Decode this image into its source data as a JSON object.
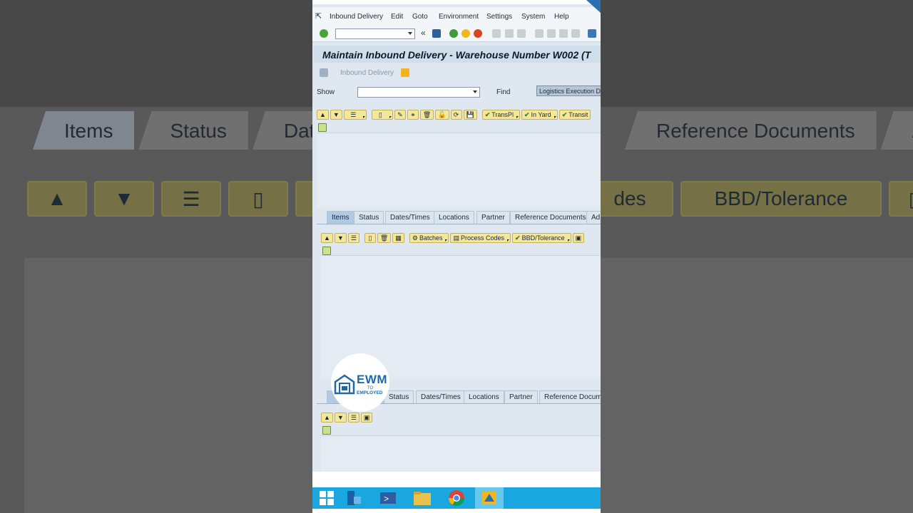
{
  "menu": [
    "Inbound Delivery",
    "Edit",
    "Goto",
    "Environment",
    "Settings",
    "System",
    "Help"
  ],
  "title": "Maintain Inbound Delivery - Warehouse Number W002 (T",
  "appbar": {
    "label": "Inbound Delivery"
  },
  "findrow": {
    "show_label": "Show",
    "find_label": "Find",
    "find_value": "Logistics Execution De"
  },
  "top_toolbar": {
    "transpl": "TransPl",
    "in_yard": "In Yard",
    "transit": "Transit"
  },
  "items_tabs": [
    "Items",
    "Status",
    "Dates/Times",
    "Locations",
    "Partner",
    "Reference Documents",
    "Ad"
  ],
  "items_toolbar": {
    "batches": "Batches",
    "process_codes": "Process Codes",
    "bbd": "BBD/Tolerance"
  },
  "lower_tabs": [
    "Status",
    "Dates/Times",
    "Locations",
    "Partner",
    "Reference Documen"
  ],
  "logo": {
    "name": "EWM",
    "to": "TO",
    "employed": "EMPLOYED"
  },
  "background": {
    "tabs": [
      "Items",
      "Status",
      "Dates/",
      "Reference Documents",
      "Ad"
    ],
    "buttons": [
      "des",
      "BBD/Tolerance"
    ]
  },
  "colors": {
    "taskbar": "#1aa7e0",
    "title_bg": "#cfdeeb",
    "button_bg": "#f4e79a"
  }
}
